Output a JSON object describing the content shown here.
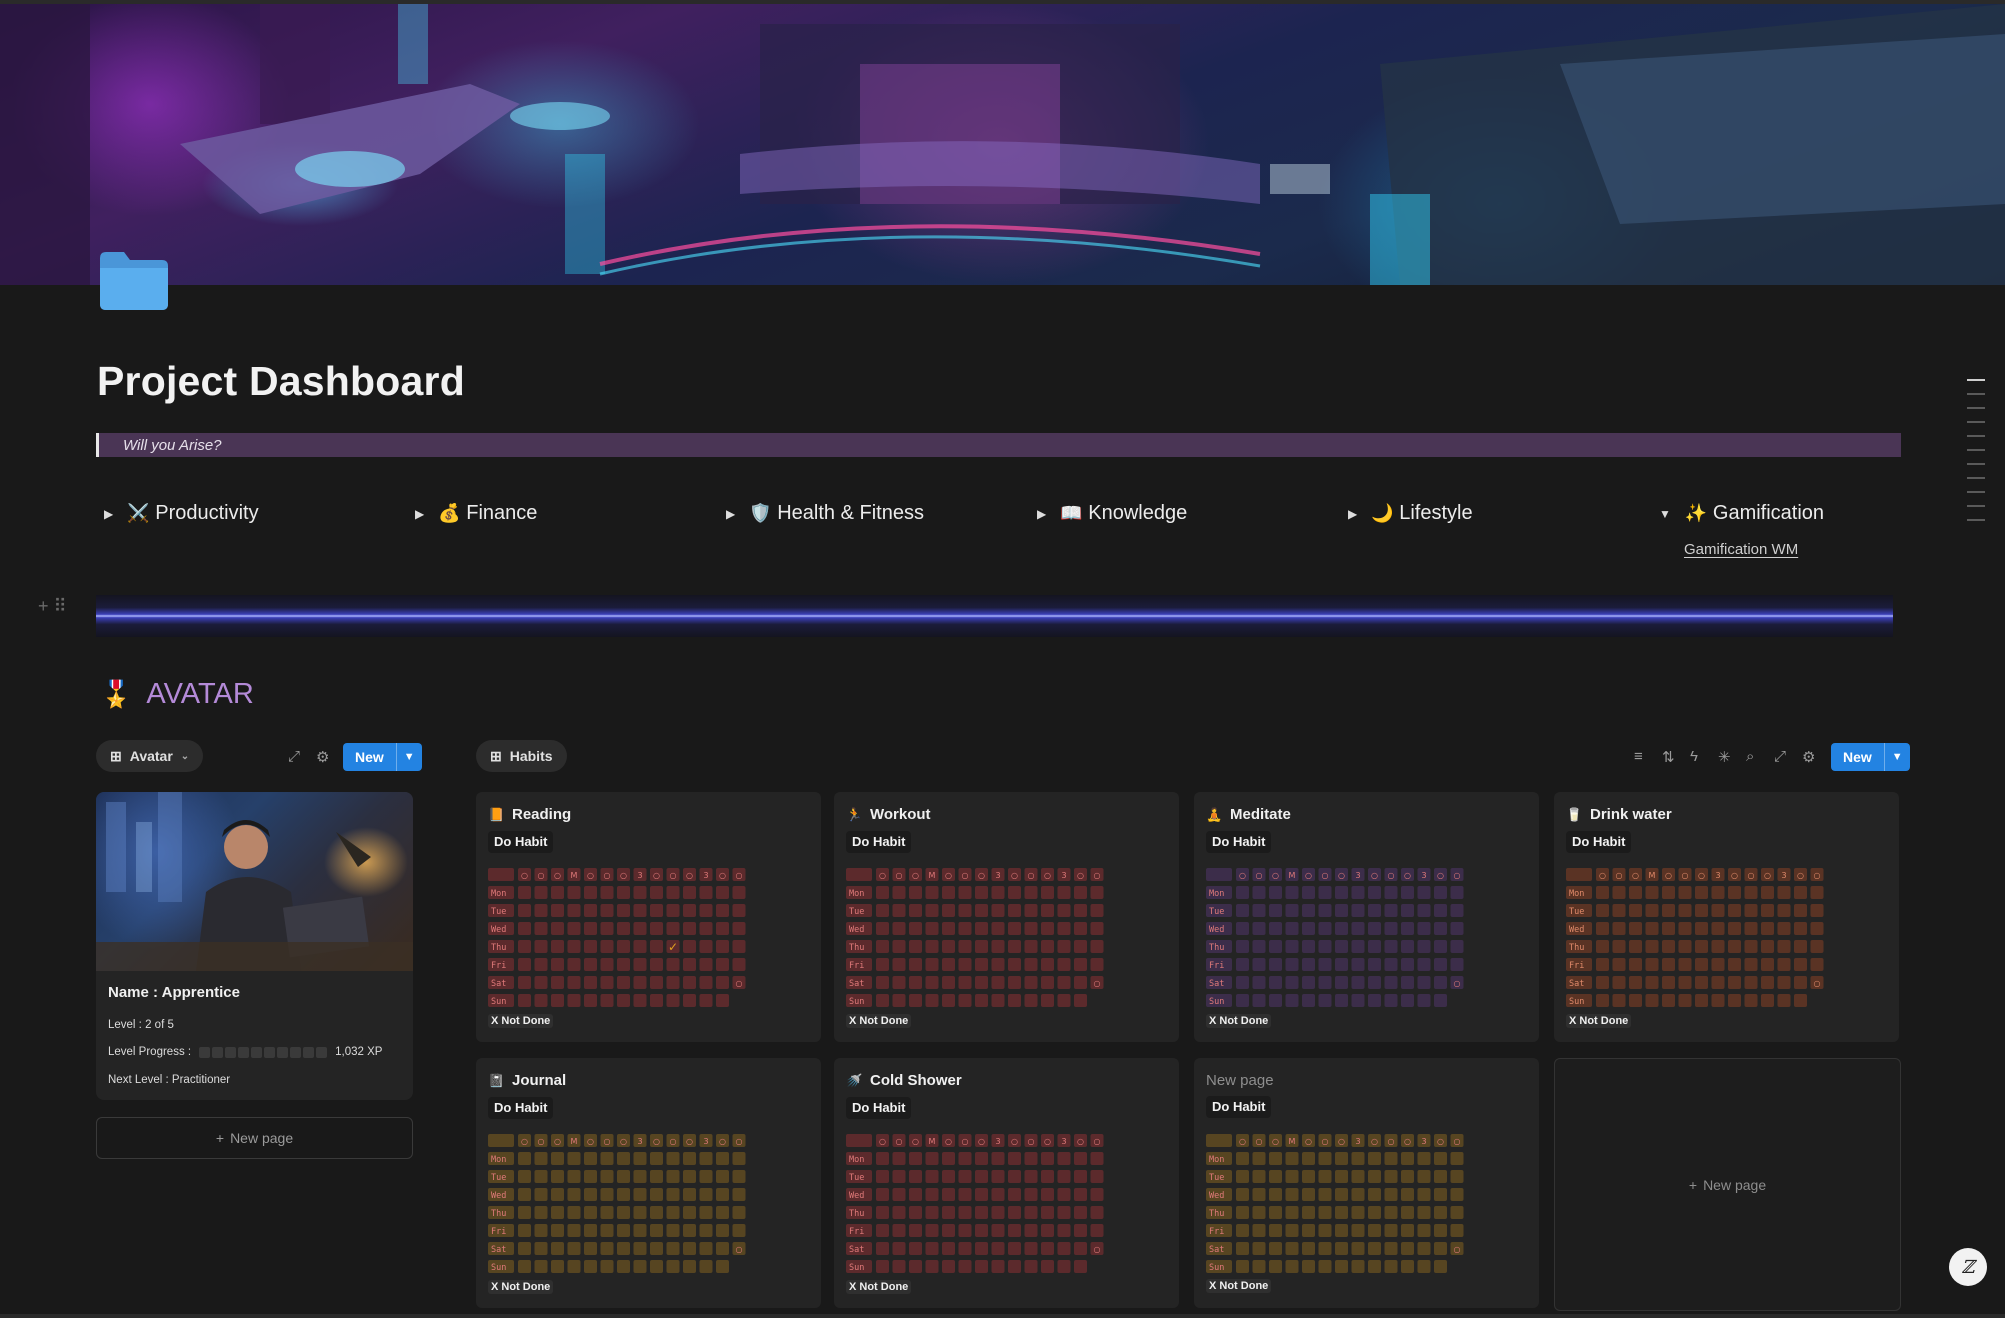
{
  "page": {
    "title": "Project Dashboard",
    "quote": "Will you Arise?"
  },
  "colors": {
    "background": "#191919",
    "accent_blue": "#2383e2",
    "quote_bg": "#4a3555",
    "section_heading": "#b48ad8"
  },
  "toggles": [
    {
      "label": "Productivity",
      "icon": "crossed-swords-icon",
      "emoji": "⚔️",
      "expanded": false
    },
    {
      "label": "Finance",
      "icon": "money-bag-icon",
      "emoji": "💰",
      "expanded": false
    },
    {
      "label": "Health & Fitness",
      "icon": "shield-icon",
      "emoji": "🛡️",
      "expanded": false
    },
    {
      "label": "Knowledge",
      "icon": "open-book-icon",
      "emoji": "📖",
      "expanded": false
    },
    {
      "label": "Lifestyle",
      "icon": "crescent-moon-icon",
      "emoji": "🌙",
      "expanded": false
    },
    {
      "label": "Gamification",
      "icon": "sparkles-icon",
      "emoji": "✨",
      "expanded": true,
      "children": [
        "Gamification WM"
      ]
    }
  ],
  "avatar_section": {
    "heading": "AVATAR",
    "heading_icon": "medal-icon",
    "view_label": "Avatar",
    "new_label": "New",
    "card": {
      "name": "Name : Apprentice",
      "level": "Level : 2 of 5",
      "progress_label": "Level Progress :",
      "progress_fraction": 0.0,
      "xp": "1,032 XP",
      "next_level": "Next Level : Practitioner"
    },
    "new_page_label": "New page"
  },
  "habits_section": {
    "view_label": "Habits",
    "new_label": "New",
    "do_habit_label": "Do Habit",
    "status_label": "X Not Done",
    "day_labels": [
      "Mon",
      "Tue",
      "Wed",
      "Thu",
      "Fri",
      "Sat",
      "Sun"
    ],
    "cards": [
      {
        "title": "Reading",
        "icon": "orange-book-icon",
        "color": "#5c2a2c",
        "label_color": "#e07a7a",
        "checked": [
          [
            3,
            9
          ]
        ]
      },
      {
        "title": "Workout",
        "icon": "running-person-icon",
        "color": "#5c2a2c",
        "label_color": "#e07a7a",
        "checked": []
      },
      {
        "title": "Meditate",
        "icon": "meditation-icon",
        "color": "#3c2d4a",
        "label_color": "#e07a7a",
        "checked": []
      },
      {
        "title": "Drink water",
        "icon": "water-glass-icon",
        "color": "#5a3324",
        "label_color": "#e08a6a",
        "checked": []
      },
      {
        "title": "Journal",
        "icon": "notebook-icon",
        "color": "#574521",
        "label_color": "#e07a7a",
        "checked": []
      },
      {
        "title": "Cold Shower",
        "icon": "shower-icon",
        "color": "#5c2a2c",
        "label_color": "#e07a7a",
        "checked": []
      },
      {
        "title": "New page",
        "icon": "",
        "color": "#574521",
        "label_color": "#e07a7a",
        "checked": [],
        "untitled": true
      }
    ],
    "new_page_label": "New page"
  }
}
